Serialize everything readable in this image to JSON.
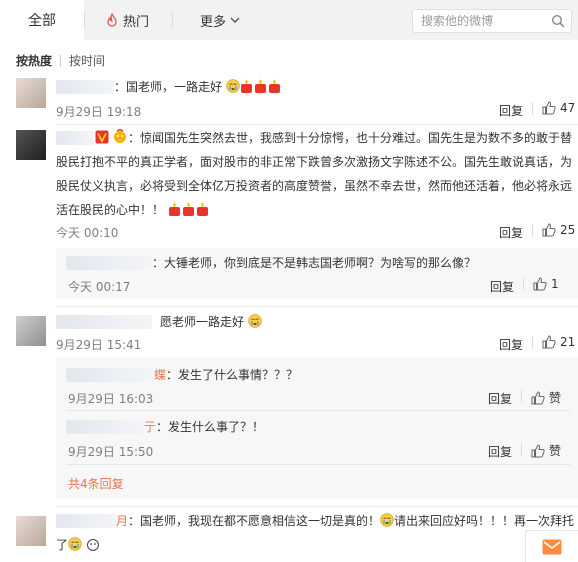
{
  "tabs": {
    "all": "全部",
    "hot": "热门",
    "more": "更多"
  },
  "search": {
    "placeholder": "搜索他的微博"
  },
  "sort": {
    "by_hot": "按热度",
    "by_time": "按时间"
  },
  "comments": [
    {
      "text": "：国老师，一路走好",
      "time": "9月29日 19:18",
      "reply": "回复",
      "likes": "47"
    },
    {
      "text": "：惊闻国先生突然去世，我感到十分惊愕，也十分难过。国先生是为数不多的敢于替股民打抱不平的真正学者，面对股市的非正常下跌曾多次激扬文字陈述不公。国先生敢说真话，为股民仗义执言，必将受到全体亿万投资者的高度赞誉，虽然不幸去世，然而他还活着，他必将永远活在股民的心中！！",
      "time": "今天 00:10",
      "reply": "回复",
      "likes": "25",
      "sub": {
        "text": "：大锤老师，你到底是不是韩志国老师啊？为啥写的那么像？",
        "time": "今天 00:17",
        "reply": "回复",
        "likes": "1"
      }
    },
    {
      "text": "愿老师一路走好",
      "time": "9月29日 15:41",
      "reply": "回复",
      "likes": "21",
      "subs": [
        {
          "name_tail": "蝶",
          "text": "：发生了什么事情？？？",
          "time": "9月29日 16:03",
          "reply": "回复",
          "likes": "赞"
        },
        {
          "name_tail": "亍",
          "text": "：发生什么事了？！",
          "time": "9月29日 15:50",
          "reply": "回复",
          "likes": "赞"
        }
      ],
      "more_replies": "共4条回复"
    },
    {
      "name_tail": "月",
      "text_a": "：国老师，我现在都不愿意相信这一切是真的！",
      "text_b": "请出来回应好吗！！！再一次拜",
      "text_c": "托了"
    }
  ],
  "colors": {
    "accent": "#eb7350",
    "tabbar": "#f2f2f5"
  }
}
